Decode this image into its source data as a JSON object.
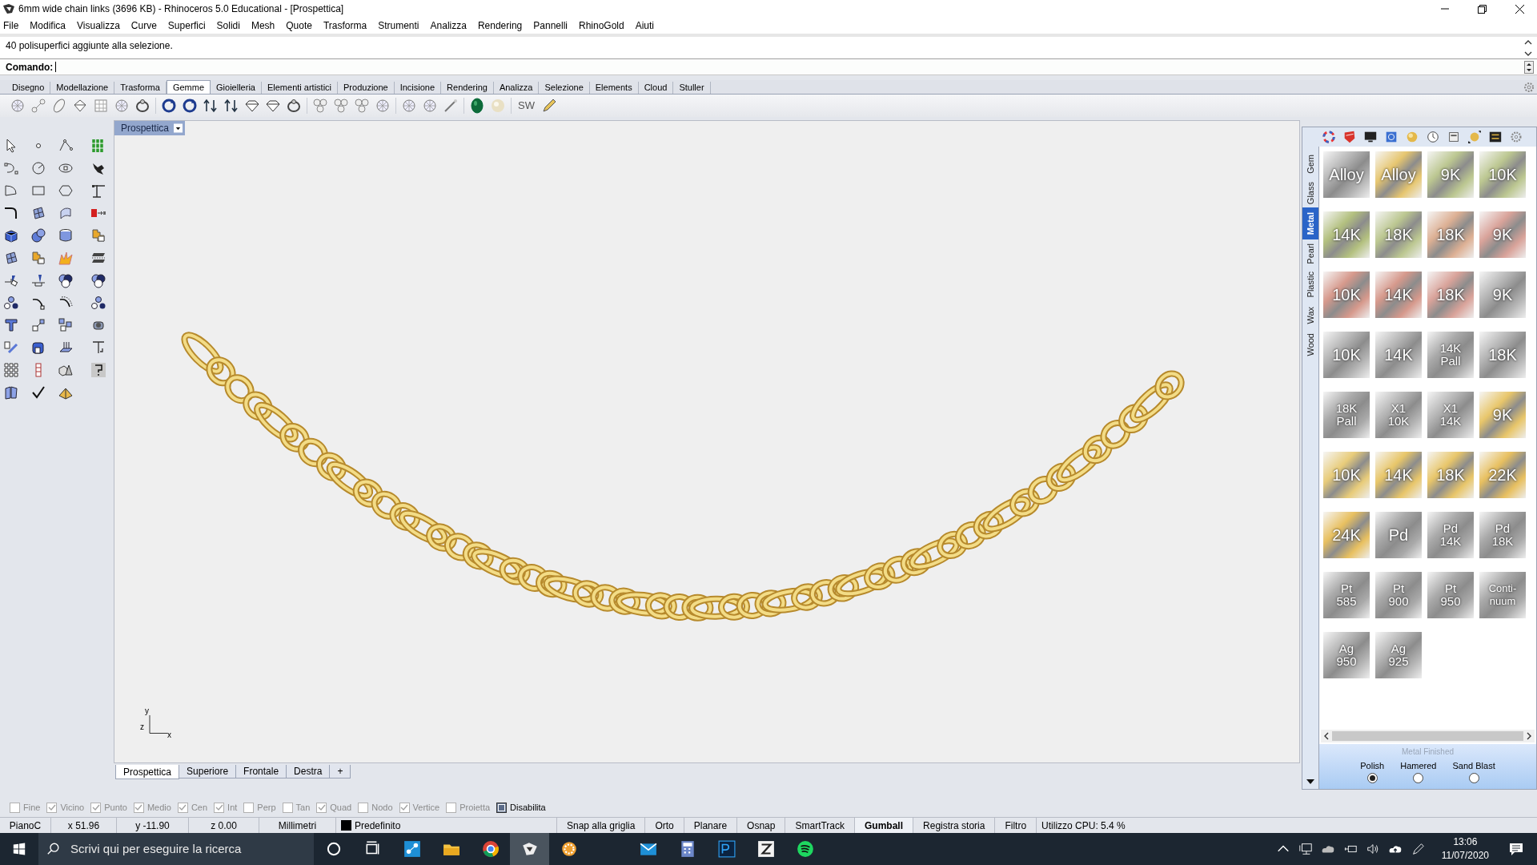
{
  "window": {
    "title": "6mm wide chain links (3696 KB) - Rhinoceros 5.0 Educational - [Prospettica]"
  },
  "menu": [
    "File",
    "Modifica",
    "Visualizza",
    "Curve",
    "Superfici",
    "Solidi",
    "Mesh",
    "Quote",
    "Trasforma",
    "Strumenti",
    "Analizza",
    "Rendering",
    "Pannelli",
    "RhinoGold",
    "Aiuti"
  ],
  "command_history": "40 polisuperfici aggiunte alla selezione.",
  "command_prompt": "Comando:",
  "ribbon_tabs": [
    {
      "label": "Disegno",
      "selected": false
    },
    {
      "label": "Modellazione",
      "selected": false
    },
    {
      "label": "Trasforma",
      "selected": false
    },
    {
      "label": "Gemme",
      "selected": true
    },
    {
      "label": "Gioielleria",
      "selected": false
    },
    {
      "label": "Elementi artistici",
      "selected": false
    },
    {
      "label": "Produzione",
      "selected": false
    },
    {
      "label": "Incisione",
      "selected": false
    },
    {
      "label": "Rendering",
      "selected": false
    },
    {
      "label": "Analizza",
      "selected": false
    },
    {
      "label": "Selezione",
      "selected": false
    },
    {
      "label": "Elements",
      "selected": false
    },
    {
      "label": "Cloud",
      "selected": false
    },
    {
      "label": "Stuller",
      "selected": false
    }
  ],
  "toolbar_text_button": "SW",
  "viewport": {
    "title": "Prospettica",
    "axis_labels": [
      "y",
      "z",
      "x"
    ]
  },
  "viewport_tabs": [
    {
      "label": "Prospettica",
      "selected": true
    },
    {
      "label": "Superiore",
      "selected": false
    },
    {
      "label": "Frontale",
      "selected": false
    },
    {
      "label": "Destra",
      "selected": false
    },
    {
      "label": "+",
      "selected": false
    }
  ],
  "material_panel": {
    "side_tabs": [
      {
        "label": "Gem",
        "selected": false
      },
      {
        "label": "Glass",
        "selected": false
      },
      {
        "label": "Metal",
        "selected": true
      },
      {
        "label": "Pearl",
        "selected": false
      },
      {
        "label": "Plastic",
        "selected": false
      },
      {
        "label": "Wax",
        "selected": false
      },
      {
        "label": "Wood",
        "selected": false
      }
    ],
    "swatches": [
      {
        "label": "Alloy",
        "color": "#b4b4b4"
      },
      {
        "label": "Alloy",
        "color": "#e6c670"
      },
      {
        "label": "9K",
        "color": "#bcc791"
      },
      {
        "label": "10K",
        "color": "#bcc791"
      },
      {
        "label": "14K",
        "color": "#b3c07f"
      },
      {
        "label": "18K",
        "color": "#bcc791"
      },
      {
        "label": "18K",
        "color": "#ddb094"
      },
      {
        "label": "9K",
        "color": "#d9a39a"
      },
      {
        "label": "10K",
        "color": "#d6998c"
      },
      {
        "label": "14K",
        "color": "#d6998c"
      },
      {
        "label": "18K",
        "color": "#d9a39a"
      },
      {
        "label": "9K",
        "color": "#b4b4b4"
      },
      {
        "label": "10K",
        "color": "#b4b4b4"
      },
      {
        "label": "14K",
        "color": "#b4b4b4"
      },
      {
        "label": "14K\nPall",
        "color": "#a9a9a9"
      },
      {
        "label": "18K",
        "color": "#b4b4b4"
      },
      {
        "label": "18K\nPall",
        "color": "#a9a9a9"
      },
      {
        "label": "X1\n10K",
        "color": "#b4b4b4"
      },
      {
        "label": "X1\n14K",
        "color": "#b4b4b4"
      },
      {
        "label": "9K",
        "color": "#e8c66a"
      },
      {
        "label": "10K",
        "color": "#e8cc7a"
      },
      {
        "label": "14K",
        "color": "#e8c66a"
      },
      {
        "label": "18K",
        "color": "#e8c66a"
      },
      {
        "label": "22K",
        "color": "#e8c060"
      },
      {
        "label": "24K",
        "color": "#e8c060"
      },
      {
        "label": "Pd",
        "color": "#a9a9a9"
      },
      {
        "label": "Pd\n14K",
        "color": "#a9a9a9"
      },
      {
        "label": "Pd\n18K",
        "color": "#a9a9a9"
      },
      {
        "label": "Pt\n585",
        "color": "#a9a9a9"
      },
      {
        "label": "Pt\n900",
        "color": "#a9a9a9"
      },
      {
        "label": "Pt\n950",
        "color": "#a9a9a9"
      },
      {
        "label": "Conti-\nnuum",
        "color": "#a9a9a9"
      },
      {
        "label": "Ag\n950",
        "color": "#b4b4b4"
      },
      {
        "label": "Ag\n925",
        "color": "#b4b4b4"
      }
    ],
    "finish_title": "Metal Finished",
    "finishes": [
      {
        "label": "Polish",
        "selected": true
      },
      {
        "label": "Hamered",
        "selected": false
      },
      {
        "label": "Sand Blast",
        "selected": false
      }
    ]
  },
  "osnaps": [
    {
      "label": "Fine",
      "checked": false,
      "disabled": true
    },
    {
      "label": "Vicino",
      "checked": true,
      "disabled": true
    },
    {
      "label": "Punto",
      "checked": true,
      "disabled": true
    },
    {
      "label": "Medio",
      "checked": true,
      "disabled": true
    },
    {
      "label": "Cen",
      "checked": true,
      "disabled": true
    },
    {
      "label": "Int",
      "checked": true,
      "disabled": true
    },
    {
      "label": "Perp",
      "checked": false,
      "disabled": true
    },
    {
      "label": "Tan",
      "checked": false,
      "disabled": true
    },
    {
      "label": "Quad",
      "checked": true,
      "disabled": true
    },
    {
      "label": "Nodo",
      "checked": false,
      "disabled": true
    },
    {
      "label": "Vertice",
      "checked": true,
      "disabled": true
    },
    {
      "label": "Proietta",
      "checked": false,
      "disabled": true
    },
    {
      "label": "Disabilita",
      "checked": true,
      "disabled": false
    }
  ],
  "status_bar": {
    "fields": [
      "PianoC",
      "x 51.96",
      "y -11.90",
      "z 0.00",
      "Millimetri"
    ],
    "layer": "Predefinito",
    "toggles": [
      {
        "label": "Snap alla griglia",
        "on": false
      },
      {
        "label": "Orto",
        "on": false
      },
      {
        "label": "Planare",
        "on": false
      },
      {
        "label": "Osnap",
        "on": false
      },
      {
        "label": "SmartTrack",
        "on": false
      },
      {
        "label": "Gumball",
        "on": true
      },
      {
        "label": "Registra storia",
        "on": false
      },
      {
        "label": "Filtro",
        "on": false
      }
    ],
    "cpu": "Utilizzo CPU: 5.4 %"
  },
  "taskbar": {
    "search_placeholder": "Scrivi qui per eseguire la ricerca",
    "time": "13:06",
    "date": "11/07/2020"
  }
}
